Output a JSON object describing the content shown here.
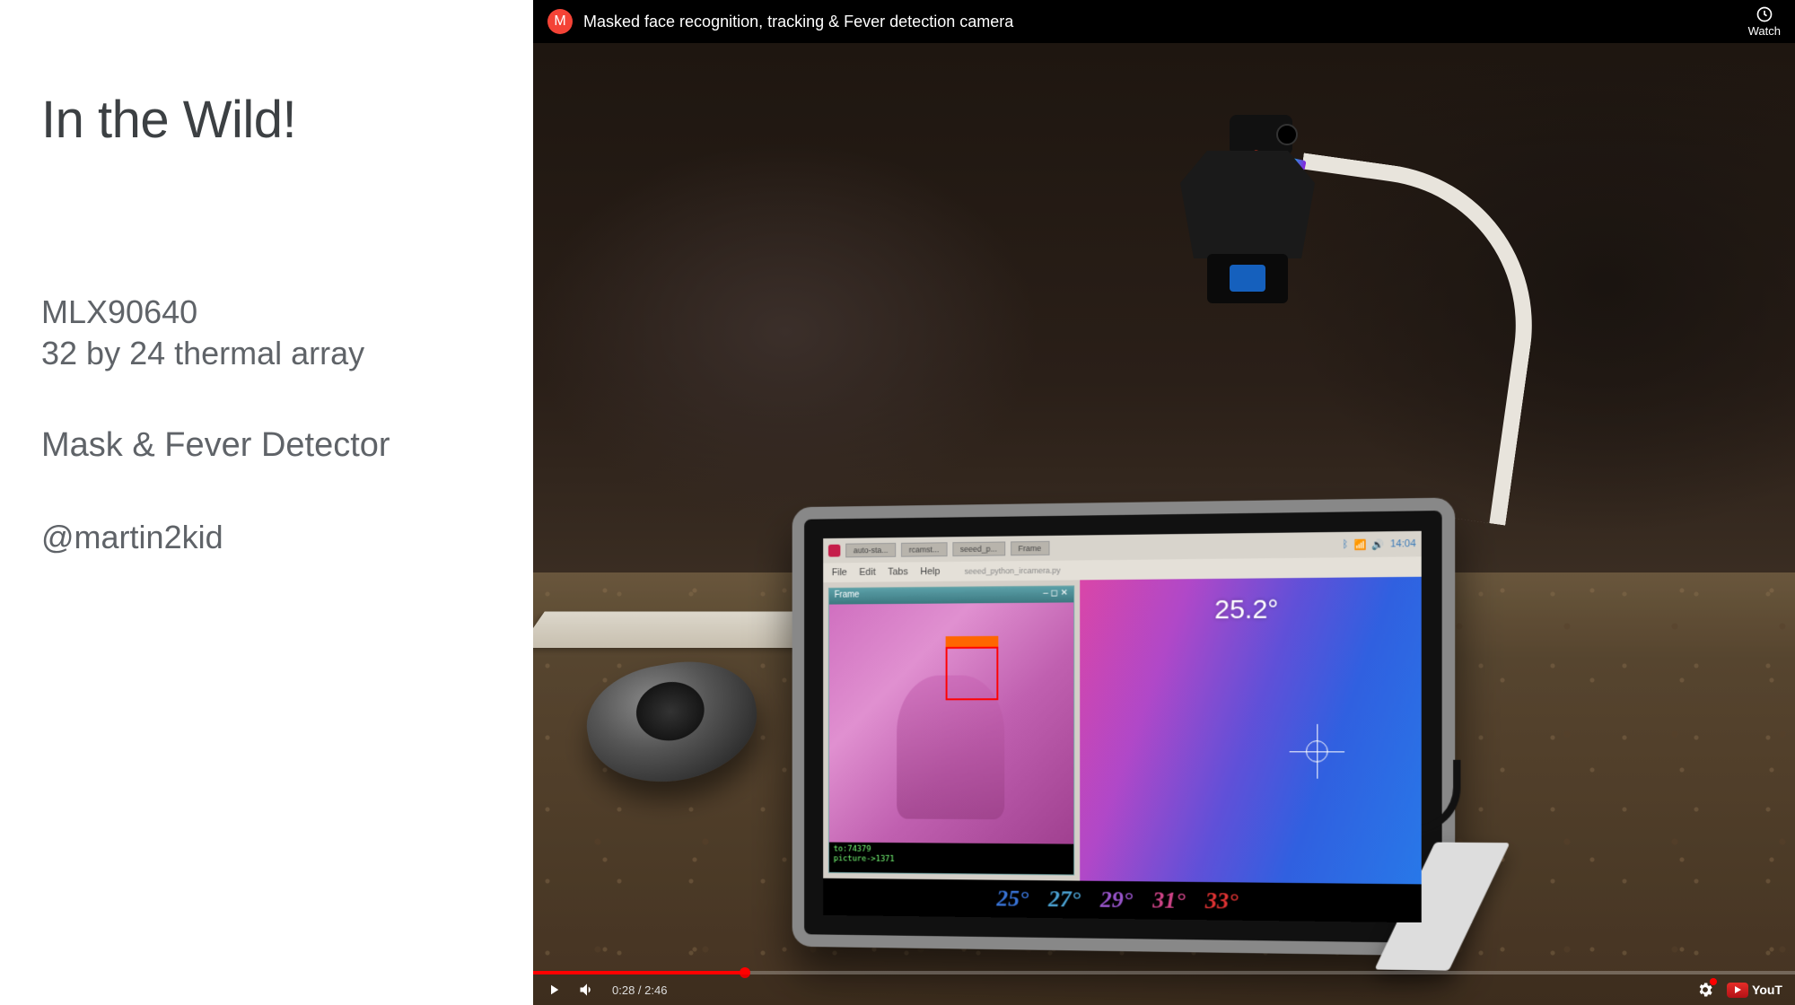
{
  "slide": {
    "title": "In the Wild!",
    "product_name": "MLX90640",
    "product_sub": "32 by 24 thermal array",
    "project_name": "Mask & Fever Detector",
    "author": "@martin2kid"
  },
  "video": {
    "channel_initial": "M",
    "title": "Masked face recognition, tracking & Fever detection camera",
    "watch_later_label": "Watch",
    "time_current": "0:28",
    "time_total": "2:46",
    "logo_text": "YouT"
  },
  "tablet": {
    "taskbar": {
      "items": [
        "auto-sta...",
        "rcamst...",
        "seeed_p...",
        "Frame"
      ],
      "clock": "14:04"
    },
    "menubar": [
      "File",
      "Edit",
      "Tabs",
      "Help"
    ],
    "camera_window_title": "Frame",
    "terminal_line1": "to:74379",
    "terminal_line2": "picture->1371",
    "thermal_reading": "25.2°",
    "temp_scale": [
      "25°",
      "27°",
      "29°",
      "31°",
      "33°"
    ],
    "script_hint": "seeed_python_ircamera.py"
  }
}
